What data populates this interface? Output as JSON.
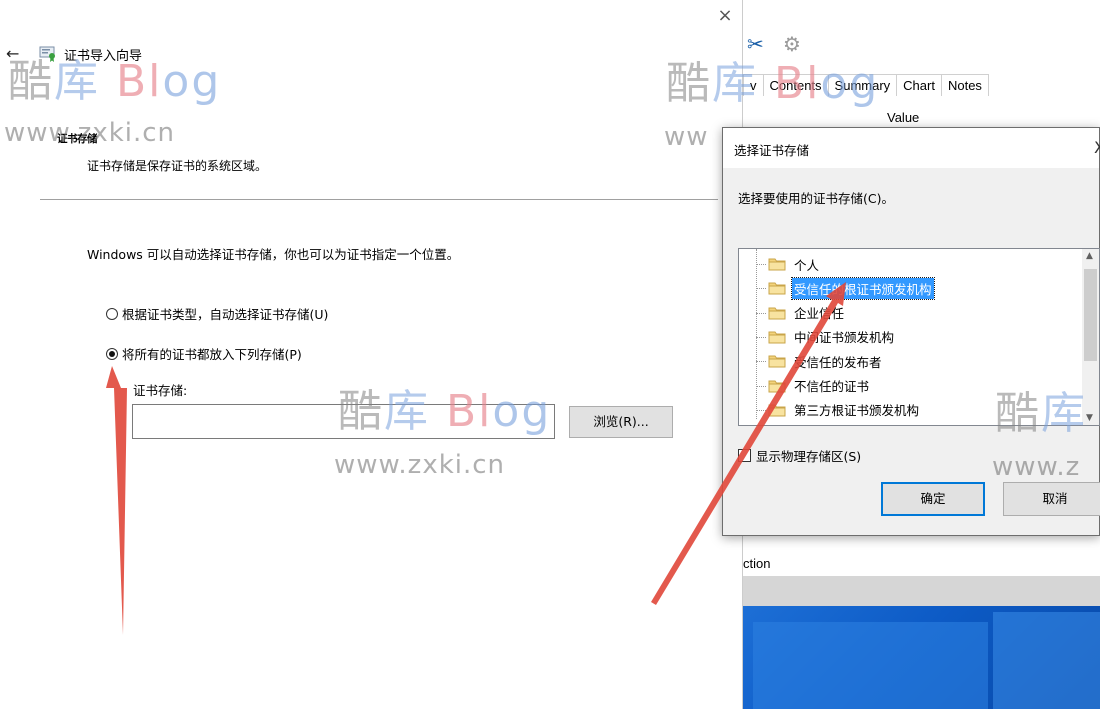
{
  "wizard": {
    "back_glyph": "←",
    "close_glyph": "×",
    "title": "证书导入向导",
    "section_title": "证书存储",
    "section_desc": "证书存储是保存证书的系统区域。",
    "intro": "Windows 可以自动选择证书存储，你也可以为证书指定一个位置。",
    "radio_auto": "根据证书类型，自动选择证书存储(U)",
    "radio_manual": "将所有的证书都放入下列存储(P)",
    "store_label": "证书存储:",
    "store_value": "",
    "browse_label": "浏览(R)..."
  },
  "bgapp": {
    "tab_partial": "v",
    "tabs": [
      "Contents",
      "Summary",
      "Chart",
      "Notes"
    ],
    "value_header": "Value",
    "dash": "-",
    "section_partial": "ction"
  },
  "dialog": {
    "title": "选择证书存储",
    "close_glyph": "X",
    "prompt": "选择要使用的证书存储(C)。",
    "stores": [
      "个人",
      "受信任的根证书颁发机构",
      "企业信任",
      "中间证书颁发机构",
      "受信任的发布者",
      "不信任的证书",
      "第三方根证书颁发机构"
    ],
    "selected_index": 1,
    "show_physical": "显示物理存储区(S)",
    "ok_label": "确定",
    "cancel_label": "取消"
  },
  "watermark": {
    "name_a": "酷",
    "name_b": "库",
    "name_c": "Bl",
    "name_d": "og",
    "url": "www.zxki.cn",
    "url_partial": "ww",
    "name_partial_a": "酷",
    "name_partial_b": "库",
    "url_partial_right": "www.z"
  },
  "colors": {
    "selection": "#3399ff",
    "focus_border": "#0078d7",
    "annotation_arrow": "#e0473a"
  }
}
